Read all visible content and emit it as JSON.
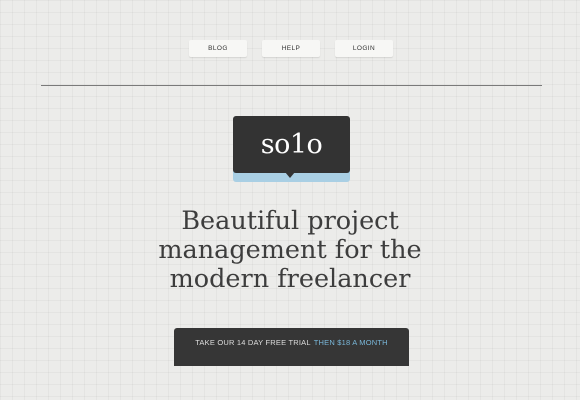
{
  "nav": {
    "items": [
      {
        "label": "BLOG"
      },
      {
        "label": "HELP"
      },
      {
        "label": "LOGIN"
      }
    ]
  },
  "logo": {
    "text": "so1o",
    "box_color": "#333333",
    "underline_color": "#a9cfe4"
  },
  "hero": {
    "headline_lines": [
      "Beautiful project",
      "management for the",
      "modern freelancer"
    ]
  },
  "cta": {
    "text": "TAKE OUR 14 DAY FREE TRIAL",
    "accent_text": "THEN $18 A MONTH",
    "accent_color": "#79b7d9",
    "background_color": "#363636"
  }
}
